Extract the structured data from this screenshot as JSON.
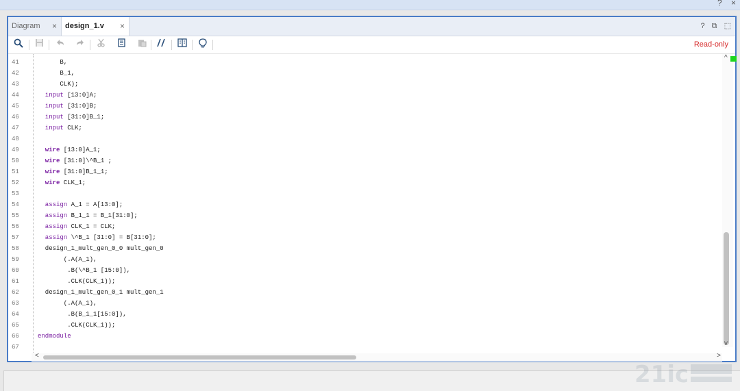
{
  "window": {
    "help_icon": "?",
    "close_icon": "×"
  },
  "tabs": [
    {
      "label": "Diagram",
      "close": "×"
    },
    {
      "label": "design_1.v",
      "close": "×"
    }
  ],
  "tab_icons": {
    "help": "?",
    "restore": "⧉",
    "maximize": "⬚"
  },
  "toolbar": {
    "icons": [
      "search-icon",
      "save-icon",
      "undo-icon",
      "redo-icon",
      "cut-icon",
      "copy-icon",
      "paste-icon",
      "comment-icon",
      "split-icon",
      "bulb-icon"
    ],
    "readonly_label": "Read-only"
  },
  "editor": {
    "lines": [
      {
        "n": "41",
        "ind": 6,
        "kw": "",
        "rest": "B,"
      },
      {
        "n": "42",
        "ind": 6,
        "kw": "",
        "rest": "B_1,"
      },
      {
        "n": "43",
        "ind": 6,
        "kw": "",
        "rest": "CLK);"
      },
      {
        "n": "44",
        "ind": 2,
        "kw": "input",
        "rest": " [13:0]A;"
      },
      {
        "n": "45",
        "ind": 2,
        "kw": "input",
        "rest": " [31:0]B;"
      },
      {
        "n": "46",
        "ind": 2,
        "kw": "input",
        "rest": " [31:0]B_1;"
      },
      {
        "n": "47",
        "ind": 2,
        "kw": "input",
        "rest": " CLK;"
      },
      {
        "n": "48",
        "ind": 0,
        "kw": "",
        "rest": ""
      },
      {
        "n": "49",
        "ind": 2,
        "kw": "wire",
        "rest": " [13:0]A_1;",
        "bold": true
      },
      {
        "n": "50",
        "ind": 2,
        "kw": "wire",
        "rest": " [31:0]\\^B_1 ;",
        "bold": true
      },
      {
        "n": "51",
        "ind": 2,
        "kw": "wire",
        "rest": " [31:0]B_1_1;",
        "bold": true
      },
      {
        "n": "52",
        "ind": 2,
        "kw": "wire",
        "rest": " CLK_1;",
        "bold": true
      },
      {
        "n": "53",
        "ind": 0,
        "kw": "",
        "rest": ""
      },
      {
        "n": "54",
        "ind": 2,
        "kw": "assign",
        "rest": " A_1 = A[13:0];"
      },
      {
        "n": "55",
        "ind": 2,
        "kw": "assign",
        "rest": " B_1_1 = B_1[31:0];"
      },
      {
        "n": "56",
        "ind": 2,
        "kw": "assign",
        "rest": " CLK_1 = CLK;"
      },
      {
        "n": "57",
        "ind": 2,
        "kw": "assign",
        "rest": " \\^B_1 [31:0] = B[31:0];"
      },
      {
        "n": "58",
        "ind": 2,
        "kw": "",
        "rest": "design_1_mult_gen_0_0 mult_gen_0"
      },
      {
        "n": "59",
        "ind": 7,
        "kw": "",
        "rest": "(.A(A_1),"
      },
      {
        "n": "60",
        "ind": 8,
        "kw": "",
        "rest": ".B(\\^B_1 [15:0]),"
      },
      {
        "n": "61",
        "ind": 8,
        "kw": "",
        "rest": ".CLK(CLK_1));"
      },
      {
        "n": "62",
        "ind": 2,
        "kw": "",
        "rest": "design_1_mult_gen_0_1 mult_gen_1"
      },
      {
        "n": "63",
        "ind": 7,
        "kw": "",
        "rest": "(.A(A_1),"
      },
      {
        "n": "64",
        "ind": 8,
        "kw": "",
        "rest": ".B(B_1_1[15:0]),"
      },
      {
        "n": "65",
        "ind": 8,
        "kw": "",
        "rest": ".CLK(CLK_1));"
      },
      {
        "n": "66",
        "ind": 0,
        "kw": "endmodule",
        "rest": ""
      },
      {
        "n": "67",
        "ind": 0,
        "kw": "",
        "rest": ""
      }
    ],
    "scroll": {
      "up": "^",
      "down": "v",
      "left": "<",
      "right": ">"
    }
  }
}
